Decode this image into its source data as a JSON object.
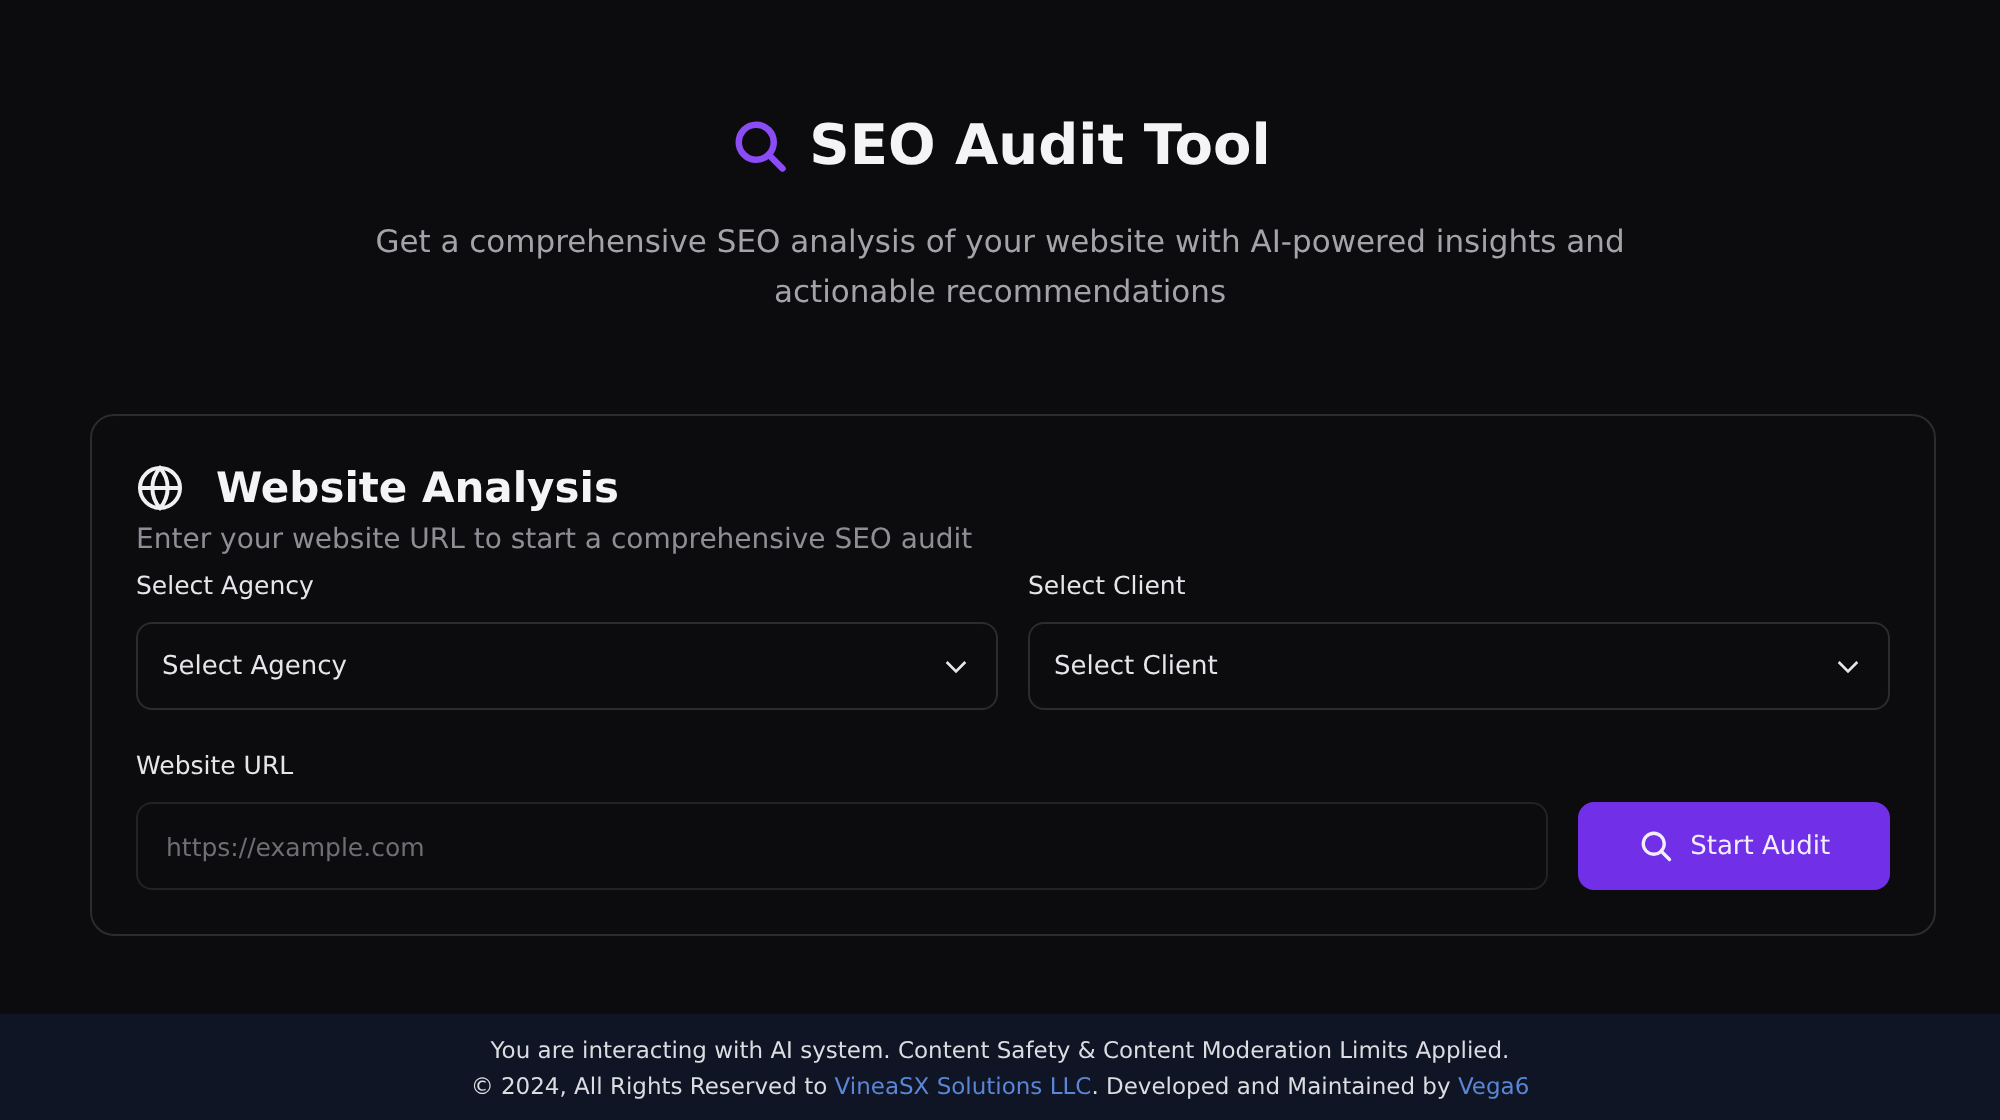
{
  "header": {
    "title": "SEO Audit Tool",
    "subtitle": "Get a comprehensive SEO analysis of your website with AI-powered insights and actionable recommendations"
  },
  "card": {
    "title": "Website Analysis",
    "description": "Enter your website URL to start a comprehensive SEO audit",
    "selects": [
      {
        "label": "Select Agency",
        "value": "Select Agency"
      },
      {
        "label": "Select Client",
        "value": "Select Client"
      }
    ],
    "url": {
      "label": "Website URL",
      "placeholder": "https://example.com"
    },
    "button": "Start Audit"
  },
  "footer": {
    "notice": "You are interacting with AI system. Content Safety & Content Moderation Limits Applied.",
    "copyright": [
      {
        "text": "© 2024, All Rights Reserved to ",
        "link": false
      },
      {
        "text": "VineaSX Solutions LLC",
        "link": true
      },
      {
        "text": ". Developed and Maintained by ",
        "link": false
      },
      {
        "text": "Vega6",
        "link": true
      }
    ]
  }
}
